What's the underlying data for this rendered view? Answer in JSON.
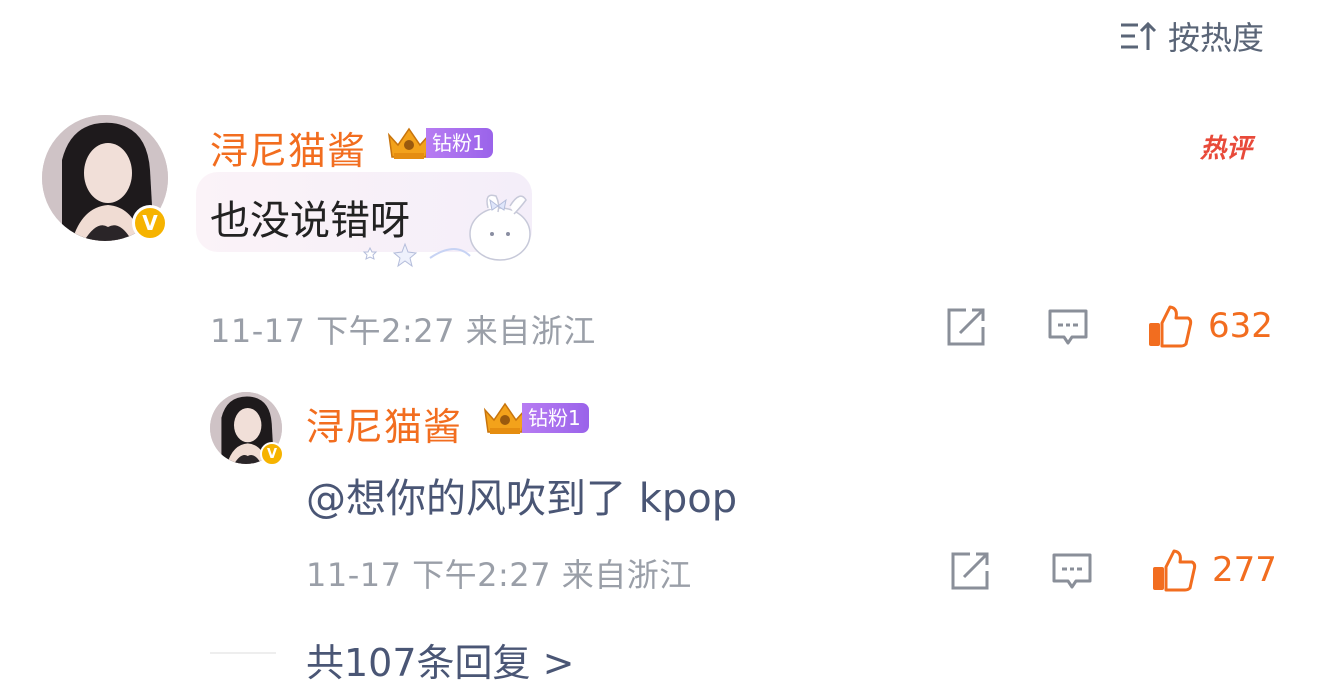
{
  "sort": {
    "label": "按热度",
    "icon": "sort-desc-icon"
  },
  "comment": {
    "username": "浔尼猫酱",
    "fan_badge": {
      "label": "钻粉1",
      "crown_icon": "crown-icon"
    },
    "hot_tag": "热评",
    "text": "也没说错呀",
    "date": "11-17",
    "time": "下午2:27",
    "location": "来自浙江",
    "likes": "632"
  },
  "reply": {
    "username": "浔尼猫酱",
    "fan_badge": {
      "label": "钻粉1"
    },
    "text": "@想你的风吹到了 kpop",
    "date": "11-17",
    "time": "下午2:27",
    "location": "来自浙江",
    "likes": "277"
  },
  "more_replies": "共107条回复 >",
  "colors": {
    "accent": "#f26d1f",
    "meta": "#9a9fa8",
    "link": "#4a5675",
    "badge_purple": "#9a63ea",
    "verified": "#f6b300"
  }
}
